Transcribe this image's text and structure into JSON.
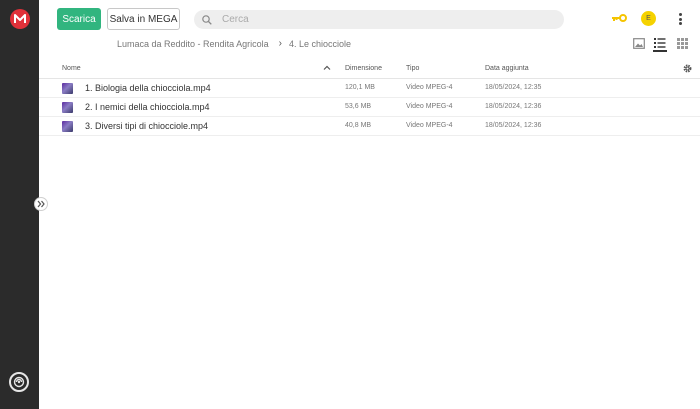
{
  "toolbar": {
    "download_label": "Scarica",
    "save_label": "Salva in MEGA"
  },
  "search": {
    "placeholder": "Cerca"
  },
  "account": {
    "avatar_initial": "E"
  },
  "breadcrumb": {
    "parent": "Lumaca da Reddito - Rendita Agricola",
    "current": "4. Le chiocciole"
  },
  "table": {
    "columns": {
      "name": "Nome",
      "size": "Dimensione",
      "type": "Tipo",
      "date": "Data aggiunta"
    },
    "rows": [
      {
        "name": "1. Biologia della chiocciola.mp4",
        "size": "120,1 MB",
        "type": "Video MPEG-4",
        "date": "18/05/2024, 12:35"
      },
      {
        "name": "2. I nemici della chiocciola.mp4",
        "size": "53,6 MB",
        "type": "Video MPEG-4",
        "date": "18/05/2024, 12:36"
      },
      {
        "name": "3. Diversi tipi di chiocciole.mp4",
        "size": "40,8 MB",
        "type": "Video MPEG-4",
        "date": "18/05/2024, 12:36"
      }
    ]
  },
  "icons": {
    "logo": "mega-logo-icon",
    "key": "key-icon",
    "more": "kebab-menu-icon",
    "search": "search-icon",
    "settings": "gear-icon"
  },
  "colors": {
    "accent_green": "#31b57f",
    "mega_red": "#e0313a",
    "sidebar_bg": "#2b2b2b",
    "key_yellow": "#f5c400",
    "avatar_yellow": "#f5d200"
  }
}
